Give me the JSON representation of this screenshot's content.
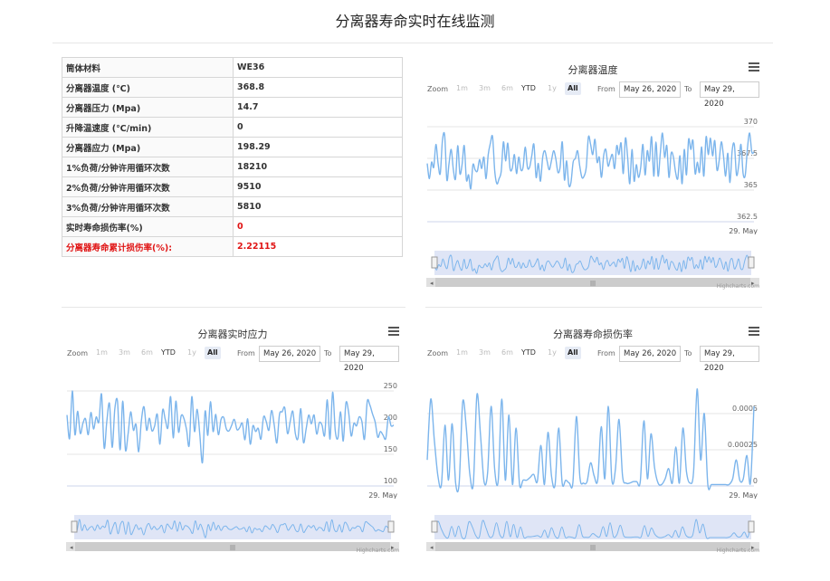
{
  "page": {
    "title": "分离器寿命实时在线监测"
  },
  "info_table": [
    {
      "key": "筒体材料",
      "value": "WE36",
      "emphasis": false
    },
    {
      "key": "分离器温度 (℃)",
      "value": "368.8",
      "emphasis": false
    },
    {
      "key": "分离器压力 (Mpa)",
      "value": "14.7",
      "emphasis": false
    },
    {
      "key": "升降温速度 (℃/min)",
      "value": "0",
      "emphasis": false
    },
    {
      "key": "分离器应力 (Mpa)",
      "value": "198.29",
      "emphasis": false
    },
    {
      "key": "1%负荷/分钟许用循环次数",
      "value": "18210",
      "emphasis": false
    },
    {
      "key": "2%负荷/分钟许用循环次数",
      "value": "9510",
      "emphasis": false
    },
    {
      "key": "3%负荷/分钟许用循环次数",
      "value": "5810",
      "emphasis": false
    },
    {
      "key": "实时寿命损伤率(%)",
      "value": "0",
      "emphasis": "value"
    },
    {
      "key": "分离器寿命累计损伤率(%):",
      "value": "2.22115",
      "emphasis": "both"
    }
  ],
  "range_selector": {
    "zoom_label": "Zoom",
    "buttons": [
      "1m",
      "3m",
      "6m",
      "YTD",
      "1y",
      "All"
    ],
    "enabled": [
      false,
      false,
      false,
      true,
      false,
      true
    ],
    "selected": "All",
    "from_label": "From",
    "from_value": "May 26, 2020",
    "to_label": "To",
    "to_value": "May 29, 2020"
  },
  "credits": "Highcharts.com",
  "colors": {
    "line": "#7cb5ec",
    "navigator_fill": "#d9e1f5",
    "grid": "#e6e6e6",
    "emphasis_red": "#e01414"
  },
  "chart_data": [
    {
      "type": "line",
      "title": "分离器温度",
      "x_label_last": "29. May",
      "yticks": [
        "370",
        "367.5",
        "365",
        "362.5"
      ],
      "ylim": [
        362.5,
        370.5
      ],
      "series": [
        {
          "values": [
            367.1,
            365.9,
            367.2,
            366.8,
            368.6,
            367.1,
            366.3,
            368.9,
            369.3,
            365.8,
            367.1,
            368.2,
            366.6,
            365.9,
            368.5,
            366.3,
            367.0,
            368.5,
            365.8,
            366.2,
            365.1,
            367.0,
            366.6,
            366.5,
            367.4,
            366.7,
            367.6,
            365.9,
            367.8,
            368.7,
            369.2,
            366.5,
            365.5,
            365.9,
            366.5,
            368.8,
            367.3,
            368.7,
            366.7,
            366.7,
            367.8,
            366.3,
            367.6,
            366.6,
            366.8,
            368.4,
            366.8,
            366.8,
            367.7,
            368.6,
            366.0,
            367.1,
            365.7,
            367.6,
            368.1,
            367.3,
            366.6,
            367.3,
            368.1,
            367.5,
            366.4,
            366.8,
            368.8,
            365.8,
            367.3,
            365.4,
            365.6,
            367.2,
            367.5,
            368.1,
            366.9,
            366.0,
            366.1,
            366.8,
            369.2,
            368.6,
            367.8,
            369.0,
            367.2,
            367.6,
            366.0,
            367.7,
            368.2,
            366.9,
            367.4,
            367.8,
            366.7,
            368.5,
            367.8,
            368.7,
            366.3,
            369.1,
            367.6,
            365.5,
            368.2,
            365.7,
            367.0,
            366.0,
            366.8,
            368.6,
            366.2,
            368.1,
            367.3,
            369.2,
            366.1,
            368.8,
            366.1,
            367.9,
            369.5,
            367.6,
            368.5,
            366.0,
            367.9,
            367.6,
            366.4,
            365.9,
            367.7,
            365.5,
            368.2,
            366.2,
            369.0,
            368.2,
            368.9,
            366.3,
            367.2,
            366.4,
            368.4,
            366.1,
            369.2,
            367.8,
            369.1,
            367.7,
            368.9,
            366.6,
            367.3,
            368.8,
            367.7,
            366.1,
            367.9,
            365.6,
            368.1,
            368.6,
            366.2,
            367.0,
            368.6,
            366.3,
            366.2,
            368.3,
            369.5,
            368.0,
            368.0
          ]
        }
      ]
    },
    {
      "type": "line",
      "title": "分离器实时应力",
      "x_label_last": "29. May",
      "yticks": [
        "250",
        "200",
        "150",
        "100"
      ],
      "ylim": [
        100,
        260
      ],
      "series": [
        {
          "values": [
            212,
            175,
            250,
            181,
            218,
            183,
            199,
            206,
            181,
            216,
            190,
            209,
            201,
            245,
            160,
            202,
            230,
            161,
            221,
            234,
            157,
            234,
            157,
            182,
            217,
            188,
            197,
            154,
            203,
            225,
            188,
            207,
            187,
            195,
            213,
            166,
            220,
            205,
            192,
            241,
            176,
            234,
            185,
            211,
            207,
            189,
            164,
            241,
            186,
            221,
            182,
            137,
            218,
            180,
            233,
            186,
            213,
            181,
            205,
            208,
            190,
            187,
            196,
            205,
            189,
            192,
            199,
            173,
            206,
            166,
            195,
            186,
            191,
            174,
            209,
            202,
            188,
            219,
            197,
            168,
            213,
            217,
            223,
            183,
            201,
            218,
            182,
            176,
            222,
            169,
            189,
            212,
            198,
            212,
            182,
            200,
            196,
            180,
            236,
            174,
            248,
            187,
            176,
            217,
            171,
            231,
            217,
            179,
            199,
            195,
            209,
            202,
            174,
            233,
            228,
            214,
            201,
            177,
            186,
            180,
            175,
            209,
            195,
            196
          ]
        }
      ]
    },
    {
      "type": "line",
      "title": "分离器寿命损伤率",
      "x_label_last": "29. May",
      "yticks": [
        "0.0005",
        "0.00025",
        "0"
      ],
      "ylim": [
        0,
        0.0007
      ],
      "series": [
        {
          "values": [
            0.00018,
            0.0006,
            0.00032,
            7e-05,
            1e-05,
            0.00042,
            4e-05,
            0.00043,
            2e-05,
            2e-05,
            0.00058,
            0.0004,
            8e-05,
            2e-05,
            0.00063,
            0.00035,
            3e-05,
            9e-05,
            0.00055,
            0.00011,
            4e-05,
            0.0006,
            4e-05,
            0.00049,
            1e-05,
            0.0004,
            1e-05,
            4e-05,
            4e-05,
            6e-05,
            8e-05,
            3e-05,
            0.00028,
            1e-05,
            0.00037,
            7e-05,
            1e-05,
            0.0004,
            2e-05,
            4e-05,
            2e-05,
            2e-05,
            0.00048,
            6e-05,
            2e-05,
            3e-05,
            0.00016,
            7e-05,
            4e-05,
            0.00041,
            5e-05,
            0.00055,
            4e-05,
            0.00012,
            0.00046,
            7e-05,
            2e-05,
            2e-05,
            3e-05,
            3e-05,
            3e-05,
            0.00045,
            5e-05,
            0.00036,
            0.00013,
            2e-05,
            1e-05,
            5e-05,
            0.00012,
            2e-05,
            0.00027,
            2e-05,
            0.0004,
            0.0001,
            2e-05,
            0.0001,
            0.00067,
            0.00018,
            0.0005,
            1e-05,
            1e-05,
            1e-05,
            1e-05,
            1e-05,
            1e-05,
            1e-05,
            5e-05,
            0.00018,
            4e-05,
            5e-05,
            0.00021,
            2e-05,
            0.00055
          ]
        }
      ]
    }
  ]
}
